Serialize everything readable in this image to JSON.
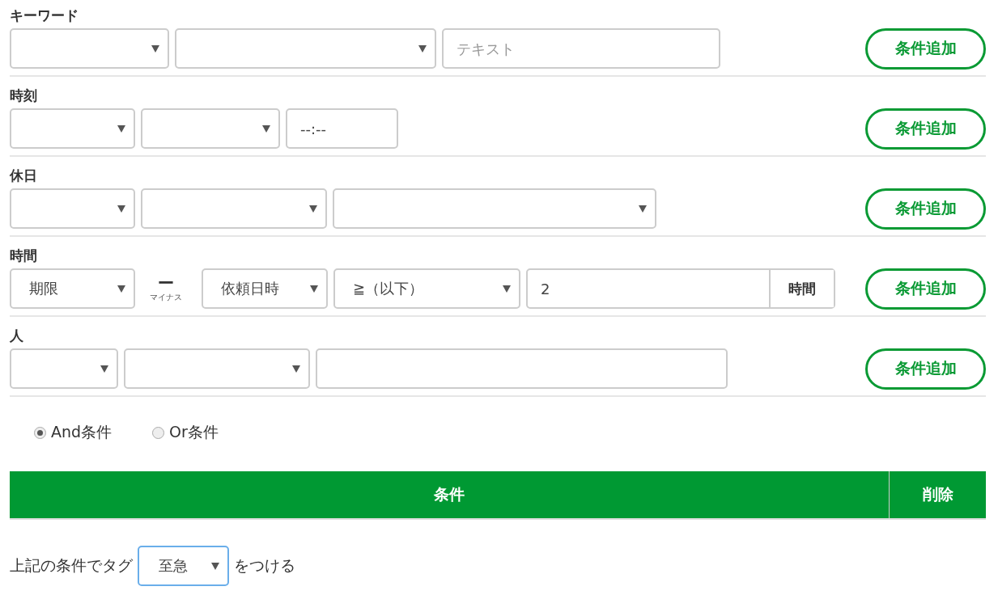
{
  "sections": [
    {
      "title": "キーワード",
      "controls": [
        {
          "kind": "select"
        },
        {
          "kind": "select"
        },
        {
          "kind": "text",
          "placeholder": "テキスト"
        }
      ],
      "add_button": "条件追加"
    },
    {
      "title": "時刻",
      "controls": [
        {
          "kind": "select"
        },
        {
          "kind": "select"
        },
        {
          "kind": "time",
          "value": "--:--"
        }
      ],
      "add_button": "条件追加"
    },
    {
      "title": "休日",
      "controls": [
        {
          "kind": "select"
        },
        {
          "kind": "select"
        },
        {
          "kind": "select"
        }
      ],
      "add_button": "条件追加"
    },
    {
      "title": "時間",
      "controls": [
        {
          "kind": "select",
          "value": "期限"
        },
        {
          "kind": "operator",
          "symbol": "ー",
          "caption": "マイナス"
        },
        {
          "kind": "select",
          "value": "依頼日時"
        },
        {
          "kind": "select",
          "value": "≧（以下）"
        },
        {
          "kind": "addon",
          "value": "2",
          "addon": "時間"
        }
      ],
      "add_button": "条件追加"
    },
    {
      "title": "人",
      "controls": [
        {
          "kind": "select"
        },
        {
          "kind": "select"
        },
        {
          "kind": "text"
        }
      ],
      "add_button": "条件追加"
    }
  ],
  "match_mode": [
    {
      "label": "And条件",
      "selected": true
    },
    {
      "label": "Or条件",
      "selected": false
    }
  ],
  "table": {
    "columns": [
      "条件",
      "削除"
    ]
  },
  "tag_line": {
    "before": "上記の条件でタグ",
    "tag": "至急",
    "after": "をつける"
  }
}
